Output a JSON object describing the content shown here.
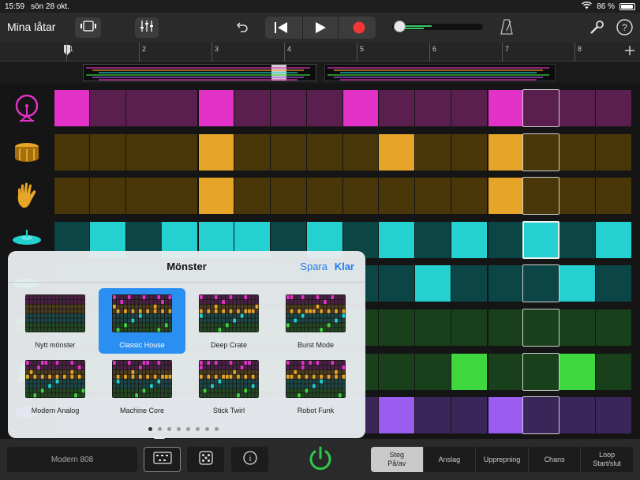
{
  "status": {
    "time": "15:59",
    "date": "sön 28 okt.",
    "battery": "86 %"
  },
  "toolbar": {
    "title": "Mina låtar"
  },
  "ruler": {
    "bars": [
      "1",
      "2",
      "3",
      "4",
      "5",
      "6",
      "7",
      "8"
    ]
  },
  "colors": {
    "pink": "#e232c8",
    "orange": "#e6a528",
    "teal": "#24d0d0",
    "green": "#3ed83e",
    "purple": "#9b5cf0",
    "record": "#f33636",
    "accent": "#1a7ef0",
    "power": "#2ec84a"
  },
  "popup": {
    "title": "Mönster",
    "save": "Spara",
    "done": "Klar",
    "patterns": [
      {
        "label": "Nytt mönster",
        "selected": false
      },
      {
        "label": "Classic House",
        "selected": true
      },
      {
        "label": "Deep Crate",
        "selected": false
      },
      {
        "label": "Burst Mode",
        "selected": false
      },
      {
        "label": "Modern Analog",
        "selected": false
      },
      {
        "label": "Machine Core",
        "selected": false
      },
      {
        "label": "Stick Twirl",
        "selected": false
      },
      {
        "label": "Robot Funk",
        "selected": false
      }
    ],
    "page_dots": 8,
    "active_dot": 0
  },
  "bottom": {
    "kit": "Modern 808",
    "modes": [
      {
        "line1": "Steg",
        "line2": "På/av",
        "active": true
      },
      {
        "line1": "Anslag",
        "line2": "",
        "active": false
      },
      {
        "line1": "Upprepning",
        "line2": "",
        "active": false
      },
      {
        "line1": "Chans",
        "line2": "",
        "active": false
      },
      {
        "line1": "Loop",
        "line2": "Start/slut",
        "active": false
      }
    ]
  },
  "grid": {
    "playhead_step": 13,
    "rows": [
      {
        "instrument": "kick-drum-icon",
        "color": "pink",
        "dim": "#5a1f4f",
        "steps": [
          1,
          0,
          0,
          0,
          1,
          0,
          0,
          0,
          1,
          0,
          0,
          0,
          1,
          0,
          0,
          0
        ]
      },
      {
        "instrument": "snare-drum-icon",
        "color": "orange",
        "dim": "#4a3709",
        "steps": [
          0,
          0,
          0,
          0,
          1,
          0,
          0,
          0,
          0,
          1,
          0,
          0,
          1,
          0,
          0,
          0
        ]
      },
      {
        "instrument": "clap-hand-icon",
        "color": "orange",
        "dim": "#4a3709",
        "steps": [
          0,
          0,
          0,
          0,
          1,
          0,
          0,
          0,
          0,
          0,
          0,
          0,
          1,
          0,
          0,
          0
        ]
      },
      {
        "instrument": "hihat-cymbal-icon",
        "color": "teal",
        "dim": "#0c4545",
        "steps": [
          0,
          1,
          0,
          1,
          1,
          1,
          0,
          1,
          0,
          1,
          0,
          1,
          0,
          1,
          0,
          1
        ]
      },
      {
        "instrument": "open-hihat-icon",
        "color": "teal",
        "dim": "#0c4545",
        "steps": [
          0,
          0,
          0,
          0,
          0,
          0,
          0,
          0,
          0,
          0,
          1,
          0,
          0,
          0,
          1,
          0
        ]
      },
      {
        "instrument": "tom-icon",
        "color": "green",
        "dim": "#18401a",
        "steps": [
          0,
          0,
          0,
          0,
          0,
          0,
          0,
          0,
          0,
          0,
          0,
          0,
          0,
          0,
          0,
          0
        ]
      },
      {
        "instrument": "cowbell-icon",
        "color": "green",
        "dim": "#18401a",
        "steps": [
          0,
          0,
          0,
          0,
          0,
          0,
          0,
          0,
          0,
          0,
          0,
          1,
          0,
          0,
          1,
          0
        ]
      },
      {
        "instrument": "percussion-icon",
        "color": "purple",
        "dim": "#3a2658",
        "steps": [
          0,
          0,
          0,
          0,
          0,
          0,
          0,
          0,
          0,
          1,
          0,
          0,
          1,
          0,
          0,
          0
        ]
      }
    ]
  }
}
